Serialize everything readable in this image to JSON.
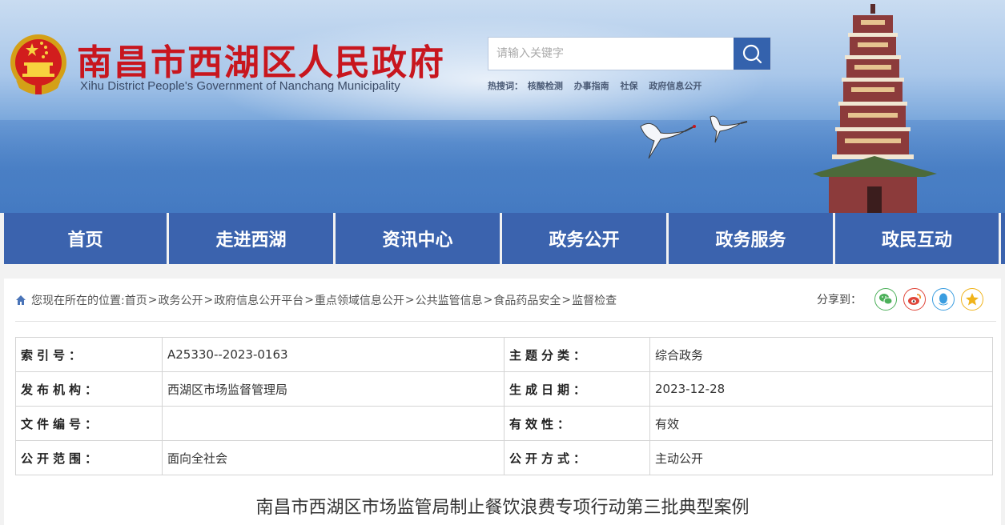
{
  "header": {
    "title": "南昌市西湖区人民政府",
    "subtitle": "Xihu District People's Government of Nanchang Municipality"
  },
  "search": {
    "placeholder": "请输入关键字",
    "hot_label": "热搜词：",
    "hot_words": [
      "核酸检测",
      "办事指南",
      "社保",
      "政府信息公开"
    ]
  },
  "nav": [
    "首页",
    "走进西湖",
    "资讯中心",
    "政务公开",
    "政务服务",
    "政民互动"
  ],
  "breadcrumb": {
    "prefix": "您现在所在的位置:",
    "items": [
      "首页",
      "政务公开",
      "政府信息公开平台",
      "重点领域信息公开",
      "公共监管信息",
      "食品药品安全",
      "监督检查"
    ],
    "separator": ">"
  },
  "share": {
    "label": "分享到：",
    "icons": [
      "wechat-icon",
      "weibo-icon",
      "qq-icon",
      "qzone-icon"
    ]
  },
  "colors": {
    "title_red": "#c8161e",
    "nav_blue": "#3b63ae",
    "search_blue": "#3462ad"
  },
  "info": [
    [
      "索引号：",
      "A25330--2023-0163",
      "主题分类：",
      "综合政务"
    ],
    [
      "发布机构：",
      "西湖区市场监督管理局",
      "生成日期：",
      "2023-12-28"
    ],
    [
      "文件编号：",
      "",
      "有效性：",
      "有效"
    ],
    [
      "公开范围：",
      "面向全社会",
      "公开方式：",
      "主动公开"
    ]
  ],
  "article": {
    "title": "南昌市西湖区市场监管局制止餐饮浪费专项行动第三批典型案例"
  }
}
